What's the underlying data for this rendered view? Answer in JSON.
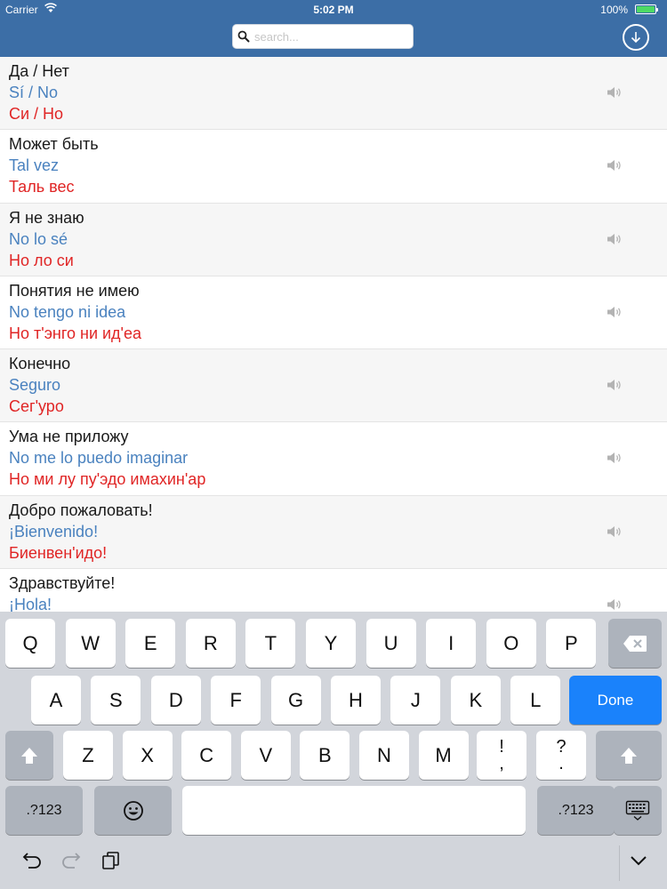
{
  "status": {
    "carrier": "Carrier",
    "time": "5:02 PM",
    "battery": "100%"
  },
  "search": {
    "placeholder": "search..."
  },
  "phrases": [
    {
      "ru": "Да / Нет",
      "es": "Sí / No",
      "tr": "Си / Но"
    },
    {
      "ru": "Может быть",
      "es": "Tal vez",
      "tr": "Таль вес"
    },
    {
      "ru": "Я не знаю",
      "es": "No lo sé",
      "tr": "Но ло си"
    },
    {
      "ru": "Понятия не имею",
      "es": "No tengo ni idea",
      "tr": "Но т'энго ни ид'еа"
    },
    {
      "ru": "Конечно",
      "es": "Seguro",
      "tr": "Сег'уро"
    },
    {
      "ru": "Ума не приложу",
      "es": "No me lo puedo imaginar",
      "tr": "Но ми лу пу'эдо имахин'ар"
    },
    {
      "ru": "Добро пожаловать!",
      "es": "¡Bienvenido!",
      "tr": "Биенвен'идо!"
    },
    {
      "ru": "Здравствуйте!",
      "es": "¡Hola!",
      "tr": ""
    }
  ],
  "keyboard": {
    "row1": [
      "Q",
      "W",
      "E",
      "R",
      "T",
      "Y",
      "U",
      "I",
      "O",
      "P"
    ],
    "row2": [
      "A",
      "S",
      "D",
      "F",
      "G",
      "H",
      "J",
      "K",
      "L"
    ],
    "row3": [
      "Z",
      "X",
      "C",
      "V",
      "B",
      "N",
      "M"
    ],
    "punct1": [
      "!",
      ","
    ],
    "punct2": [
      "?",
      "."
    ],
    "done": "Done",
    "numbers": ".?123"
  },
  "colors": {
    "nav": "#3C6EA6",
    "russian": "#1a1a1a",
    "spanish": "#4a82bf",
    "transliteration": "#e02525",
    "done": "#1a82fb"
  },
  "icons": [
    "wifi-icon",
    "search-icon",
    "download-icon",
    "speaker-icon",
    "delete-icon",
    "shift-icon",
    "emoji-icon",
    "keyboard-hide-icon",
    "undo-icon",
    "redo-icon",
    "paste-icon",
    "chevron-down-icon"
  ]
}
